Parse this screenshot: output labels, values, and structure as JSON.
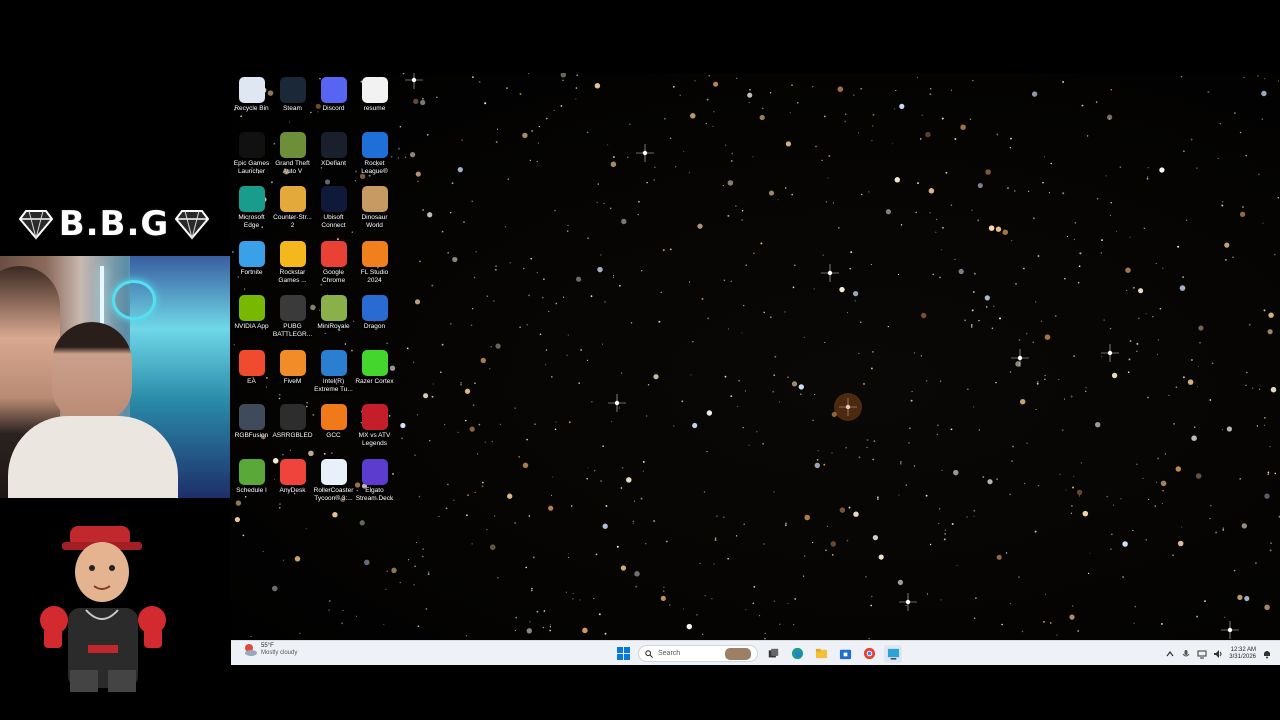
{
  "overlay": {
    "channel_tag": "B.B.G"
  },
  "desktop": {
    "icons": [
      {
        "label": "Recycle Bin",
        "icon": "recycle-bin-icon",
        "color": "#dfe8f2"
      },
      {
        "label": "Steam",
        "icon": "steam-icon",
        "color": "#1b2838"
      },
      {
        "label": "Discord",
        "icon": "discord-icon",
        "color": "#5865f2"
      },
      {
        "label": "resume",
        "icon": "document-icon",
        "color": "#f2f2f2"
      },
      {
        "label": "Epic Games\nLauncher",
        "icon": "epic-games-icon",
        "color": "#111111"
      },
      {
        "label": "Grand Theft\nAuto V",
        "icon": "gta-v-icon",
        "color": "#6e8f3a"
      },
      {
        "label": "XDefiant",
        "icon": "xdefiant-icon",
        "color": "#1a1f2e"
      },
      {
        "label": "Rocket\nLeague®",
        "icon": "rocket-league-icon",
        "color": "#1e6fd8"
      },
      {
        "label": "Microsoft\nEdge",
        "icon": "edge-icon",
        "color": "#1a9c8c"
      },
      {
        "label": "Counter-Str...\n2",
        "icon": "counter-strike-icon",
        "color": "#e3a93b"
      },
      {
        "label": "Ubisoft\nConnect",
        "icon": "ubisoft-icon",
        "color": "#0f1a3a"
      },
      {
        "label": "Dinosaur\nWorld",
        "icon": "dinosaur-world-icon",
        "color": "#c79a63"
      },
      {
        "label": "Fortnite",
        "icon": "fortnite-icon",
        "color": "#3aa0e8"
      },
      {
        "label": "Rockstar\nGames ...",
        "icon": "rockstar-icon",
        "color": "#f5b81c"
      },
      {
        "label": "Google\nChrome",
        "icon": "chrome-icon",
        "color": "#e94235"
      },
      {
        "label": "FL Studio\n2024",
        "icon": "fl-studio-icon",
        "color": "#f0801c"
      },
      {
        "label": "NVIDIA App",
        "icon": "nvidia-icon",
        "color": "#76b900"
      },
      {
        "label": "PUBG\nBATTLEGR...",
        "icon": "pubg-icon",
        "color": "#3a3a3a"
      },
      {
        "label": "MiniRoyale",
        "icon": "miniroyale-icon",
        "color": "#8ab04a"
      },
      {
        "label": "Dragon",
        "icon": "dragon-icon",
        "color": "#2a6bd1"
      },
      {
        "label": "EA",
        "icon": "ea-icon",
        "color": "#f04a2f"
      },
      {
        "label": "FiveM",
        "icon": "fivem-icon",
        "color": "#f28c28"
      },
      {
        "label": "Intel(R)\nExtreme Tu...",
        "icon": "intel-xtu-icon",
        "color": "#2a7fd1"
      },
      {
        "label": "Razer Cortex",
        "icon": "razer-cortex-icon",
        "color": "#44d62c"
      },
      {
        "label": "RGBFusion",
        "icon": "rgbfusion-icon",
        "color": "#3f4a5a"
      },
      {
        "label": "ASRRGBLED",
        "icon": "asrrgbled-icon",
        "color": "#2d2d2d"
      },
      {
        "label": "GCC",
        "icon": "gcc-icon",
        "color": "#f07a1a"
      },
      {
        "label": "MX vs ATV\nLegends",
        "icon": "mx-vs-atv-icon",
        "color": "#c41e2a"
      },
      {
        "label": "Schedule I",
        "icon": "schedule-i-icon",
        "color": "#5aa83a"
      },
      {
        "label": "AnyDesk",
        "icon": "anydesk-icon",
        "color": "#ef443b"
      },
      {
        "label": "RollerCoaster\nTycoon® 3:...",
        "icon": "rollercoaster-tycoon-icon",
        "color": "#e8f0fa"
      },
      {
        "label": "Elgato\nStream Deck",
        "icon": "stream-deck-icon",
        "color": "#5b3ccf"
      }
    ]
  },
  "taskbar": {
    "weather_temp": "55°F",
    "weather_condition": "Mostly cloudy",
    "search_placeholder": "Search",
    "clock_time": "12:32 AM",
    "clock_date": "3/31/2026",
    "pinned": [
      {
        "icon": "start-icon"
      },
      {
        "icon": "task-view-icon"
      },
      {
        "icon": "edge-taskbar-icon"
      },
      {
        "icon": "file-explorer-icon"
      },
      {
        "icon": "microsoft-store-icon"
      },
      {
        "icon": "chrome-taskbar-icon"
      },
      {
        "icon": "stream-app-icon"
      }
    ]
  }
}
